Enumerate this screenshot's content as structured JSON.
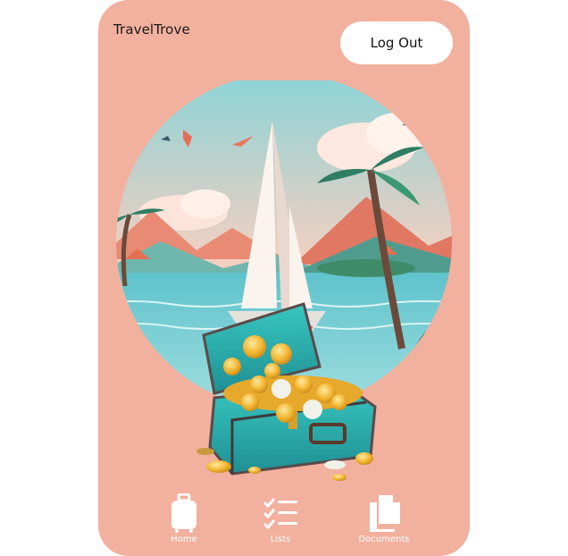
{
  "app": {
    "title": "TravelTrove"
  },
  "header": {
    "logout_label": "Log Out"
  },
  "hero": {
    "image_name": "treasure-chest-tropical-sailboat-illustration"
  },
  "nav": {
    "items": [
      {
        "label": "Home",
        "icon": "luggage-icon"
      },
      {
        "label": "Lists",
        "icon": "checklist-icon"
      },
      {
        "label": "Documents",
        "icon": "documents-icon"
      }
    ]
  },
  "colors": {
    "background": "#f2b09e",
    "button_bg": "#ffffff",
    "nav_icon": "#ffffff"
  }
}
